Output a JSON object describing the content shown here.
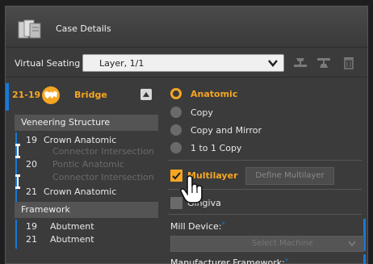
{
  "header": {
    "title": "Case Details",
    "icon": "case-folder-icon"
  },
  "virtual_seating": {
    "label": "Virtual Seating",
    "selected": "Layer, 1/1",
    "tools": [
      "seat-down-icon",
      "seat-up-icon",
      "trash-icon"
    ]
  },
  "tooth": {
    "range": "21-19",
    "type": "Bridge",
    "icon": "bridge-icon"
  },
  "veneering": {
    "title": "Veneering Structure",
    "items": [
      {
        "num": "19",
        "name": "Crown Anatomic"
      },
      {
        "num": "",
        "name": "Connector Intersection"
      },
      {
        "num": "20",
        "name": "Pontic Anatomic"
      },
      {
        "num": "",
        "name": "Connector Intersection"
      },
      {
        "num": "21",
        "name": "Crown Anatomic"
      }
    ]
  },
  "framework": {
    "title": "Framework",
    "items": [
      {
        "num": "19",
        "name": "Abutment"
      },
      {
        "num": "21",
        "name": "Abutment"
      }
    ]
  },
  "options": {
    "radios": [
      {
        "label": "Anatomic",
        "selected": true
      },
      {
        "label": "Copy",
        "selected": false
      },
      {
        "label": "Copy and Mirror",
        "selected": false
      },
      {
        "label": "1 to 1 Copy",
        "selected": false
      }
    ],
    "multilayer": {
      "label": "Multilayer",
      "checked": true
    },
    "define_button": "Define Multilayer",
    "gingiva": {
      "label": "Gingiva",
      "checked": false
    }
  },
  "fields": {
    "mill_device": "Mill Device:",
    "mill_placeholder": "Select Machine",
    "manufacturer_framework": "Manufacturer Framework:",
    "required_mark": "*"
  },
  "colors": {
    "accent": "#f5a623",
    "blue": "#1a78d4",
    "panel": "#3b3b3b"
  }
}
